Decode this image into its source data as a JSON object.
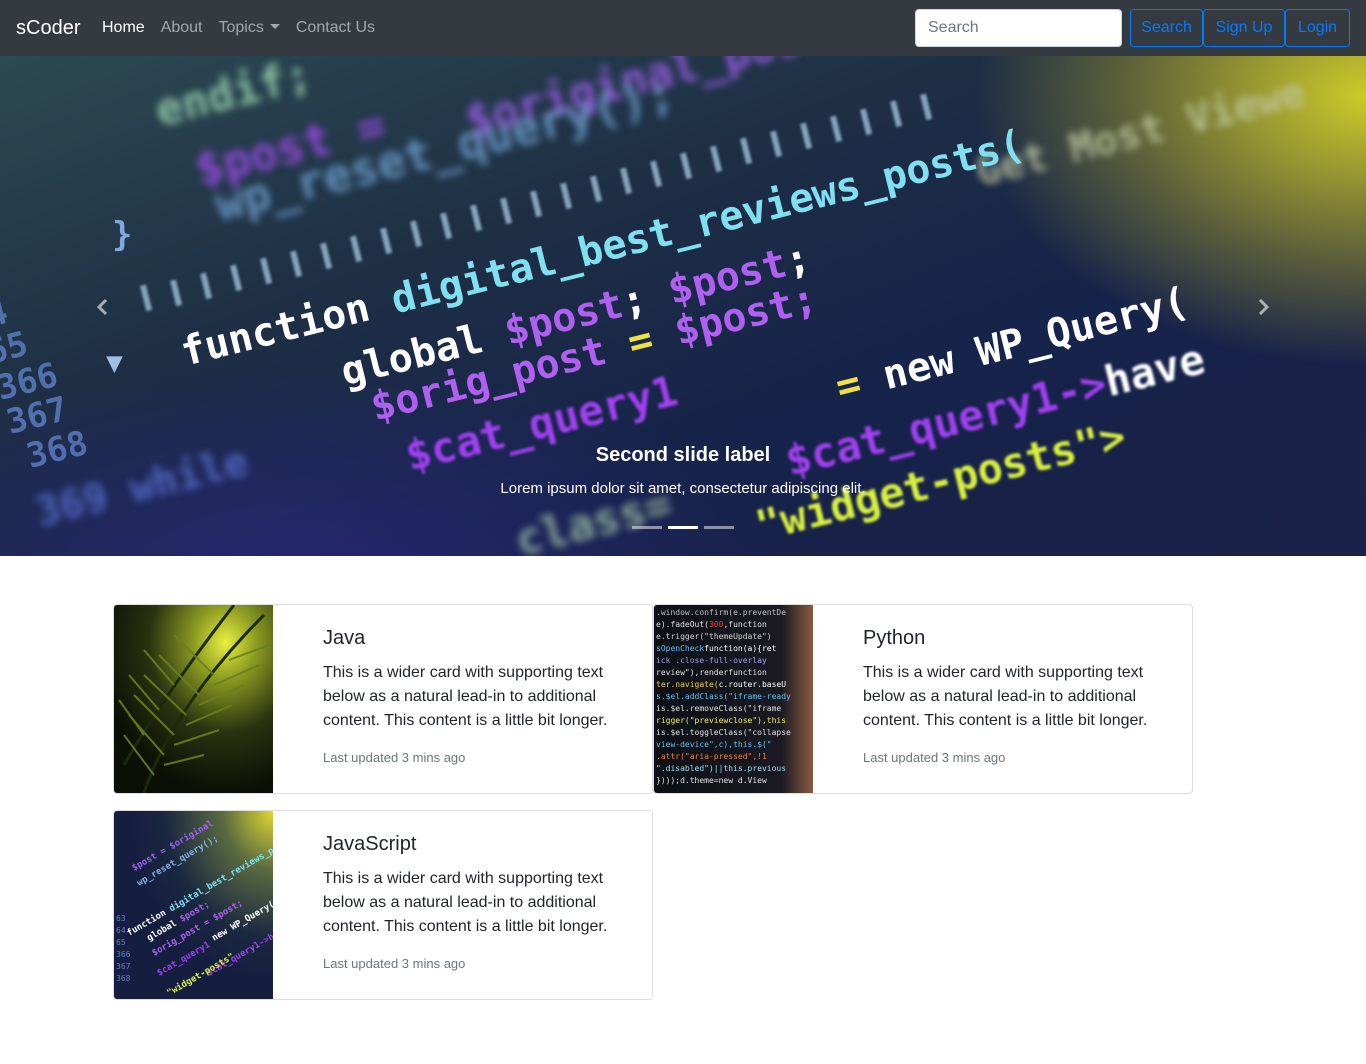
{
  "navbar": {
    "brand": "sCoder",
    "links": [
      {
        "label": "Home",
        "active": true
      },
      {
        "label": "About",
        "active": false
      },
      {
        "label": "Topics",
        "active": false,
        "dropdown": true
      },
      {
        "label": "Contact Us",
        "active": false
      }
    ],
    "search_placeholder": "Search",
    "search_button": "Search",
    "signup_button": "Sign Up",
    "login_button": "Login"
  },
  "carousel": {
    "slide_title": "Second slide label",
    "slide_text": "Lorem ipsum dolor sit amet, consectetur adipiscing elit.",
    "active_index": 1,
    "slide_count": 3,
    "prev_icon": "chevron-left-icon",
    "next_icon": "chevron-right-icon"
  },
  "cards": [
    {
      "title": "Java",
      "text": "This is a wider card with supporting text below as a natural lead-in to additional content. This content is a little bit longer.",
      "updated": "Last updated 3 mins ago",
      "image": "palm-leaves-image"
    },
    {
      "title": "Python",
      "text": "This is a wider card with supporting text below as a natural lead-in to additional content. This content is a little bit longer.",
      "updated": "Last updated 3 mins ago",
      "image": "code-screen-image"
    },
    {
      "title": "JavaScript",
      "text": "This is a wider card with supporting text below as a natural lead-in to additional content. This content is a little bit longer.",
      "updated": "Last updated 3 mins ago",
      "image": "code-closeup-image"
    }
  ],
  "colors": {
    "navbar_bg": "#343a40",
    "primary": "#007bff",
    "muted": "#6c757d"
  }
}
